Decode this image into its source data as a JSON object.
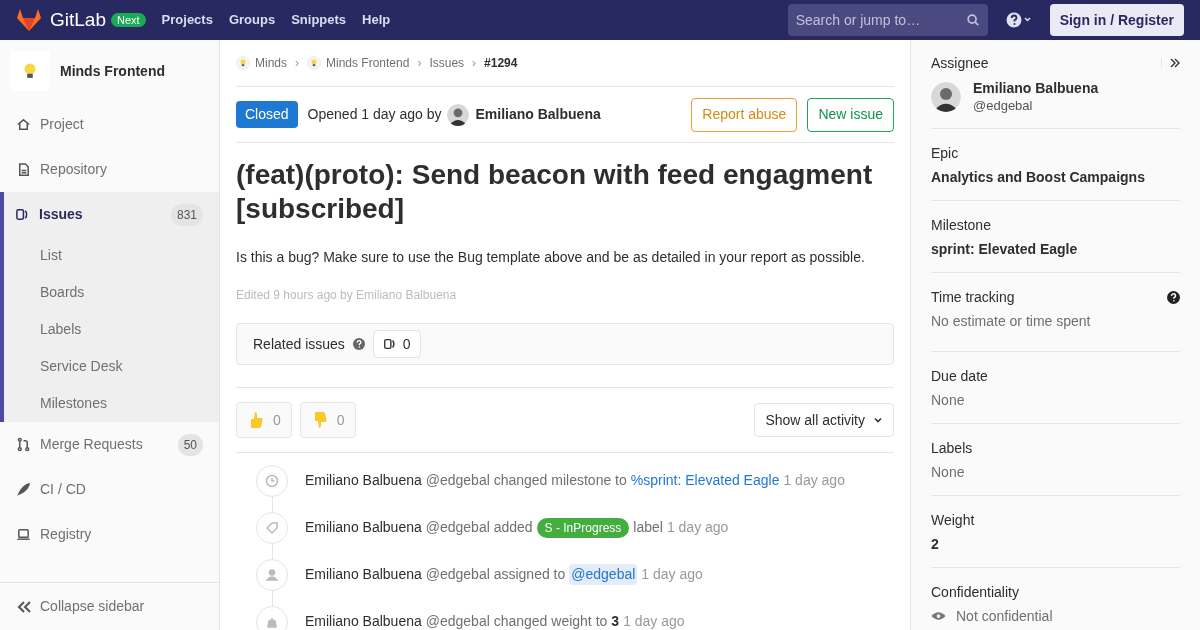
{
  "header": {
    "brand": "GitLab",
    "badge": "Next",
    "nav": [
      "Projects",
      "Groups",
      "Snippets",
      "Help"
    ],
    "search": {
      "placeholder": "Search or jump to…"
    },
    "sign_in": "Sign in / Register"
  },
  "sidebar": {
    "project": "Minds Frontend",
    "items": [
      {
        "kind": "project",
        "label": "Project",
        "selected": false
      },
      {
        "kind": "repository",
        "label": "Repository",
        "selected": false
      },
      {
        "kind": "issues",
        "label": "Issues",
        "count": "831",
        "selected": true,
        "children": [
          {
            "label": "List"
          },
          {
            "label": "Boards"
          },
          {
            "label": "Labels"
          },
          {
            "label": "Service Desk"
          },
          {
            "label": "Milestones"
          }
        ]
      },
      {
        "kind": "merge",
        "label": "Merge Requests",
        "count": "50",
        "selected": false
      },
      {
        "kind": "cicd",
        "label": "CI / CD",
        "selected": false
      },
      {
        "kind": "registry",
        "label": "Registry",
        "selected": false
      }
    ],
    "collapse": "Collapse sidebar"
  },
  "breadcrumbs": [
    "Minds",
    "Minds Frontend",
    "Issues",
    "#1294"
  ],
  "breadcrumb_separator": "›",
  "issue": {
    "status": "Closed",
    "opened": "Opened 1 day ago by",
    "author": "Emiliano Balbuena",
    "actions": [
      "Report abuse",
      "New issue"
    ],
    "title": "(feat)(proto): Send beacon with feed engagment [subscribed]",
    "description": "Is this a bug? Make sure to use the Bug template above and be as detailed in your report as possible.",
    "edited": "Edited 9 hours ago by Emiliano Balbuena",
    "related": {
      "label": "Related issues",
      "count": "0"
    },
    "reactions": [
      {
        "kind": "thumbsup",
        "count": "0"
      },
      {
        "kind": "thumbsdown",
        "count": "0"
      }
    ],
    "filter": "Show all activity"
  },
  "activity": [
    {
      "kind": "milestone",
      "parts": [
        {
          "kind": "author",
          "text": "Emiliano Balbuena"
        },
        {
          "kind": "text",
          "text": "@edgebal changed milestone to"
        },
        {
          "kind": "link",
          "text": "%sprint: Elevated Eagle"
        },
        {
          "kind": "time",
          "text": "1 day ago"
        }
      ]
    },
    {
      "kind": "label",
      "parts": [
        {
          "kind": "author",
          "text": "Emiliano Balbuena"
        },
        {
          "kind": "text",
          "text": "@edgebal added"
        },
        {
          "kind": "label",
          "text": "S - InProgress"
        },
        {
          "kind": "text",
          "text": "label"
        },
        {
          "kind": "time",
          "text": "1 day ago"
        }
      ]
    },
    {
      "kind": "assign",
      "parts": [
        {
          "kind": "author",
          "text": "Emiliano Balbuena"
        },
        {
          "kind": "text",
          "text": "@edgebal assigned to"
        },
        {
          "kind": "mention",
          "text": "@edgebal"
        },
        {
          "kind": "time",
          "text": "1 day ago"
        }
      ]
    },
    {
      "kind": "weight",
      "parts": [
        {
          "kind": "author",
          "text": "Emiliano Balbuena"
        },
        {
          "kind": "text",
          "text": "@edgebal changed weight to"
        },
        {
          "kind": "strong",
          "text": "3"
        },
        {
          "kind": "time",
          "text": "1 day ago"
        }
      ]
    }
  ],
  "right_sidebar": [
    {
      "kind": "assignee",
      "title": "Assignee",
      "name": "Emiliano Balbuena",
      "handle": "@edgebal"
    },
    {
      "kind": "bold",
      "title": "Epic",
      "value": "Analytics and Boost Campaigns"
    },
    {
      "kind": "bold",
      "title": "Milestone",
      "value": "sprint: Elevated Eagle"
    },
    {
      "kind": "help",
      "title": "Time tracking",
      "value": "No estimate or time spent"
    },
    {
      "kind": "muted",
      "title": "Due date",
      "value": "None"
    },
    {
      "kind": "muted",
      "title": "Labels",
      "value": "None"
    },
    {
      "kind": "bold",
      "title": "Weight",
      "value": "2"
    },
    {
      "kind": "eye",
      "title": "Confidentiality",
      "value": "Not confidential"
    }
  ]
}
